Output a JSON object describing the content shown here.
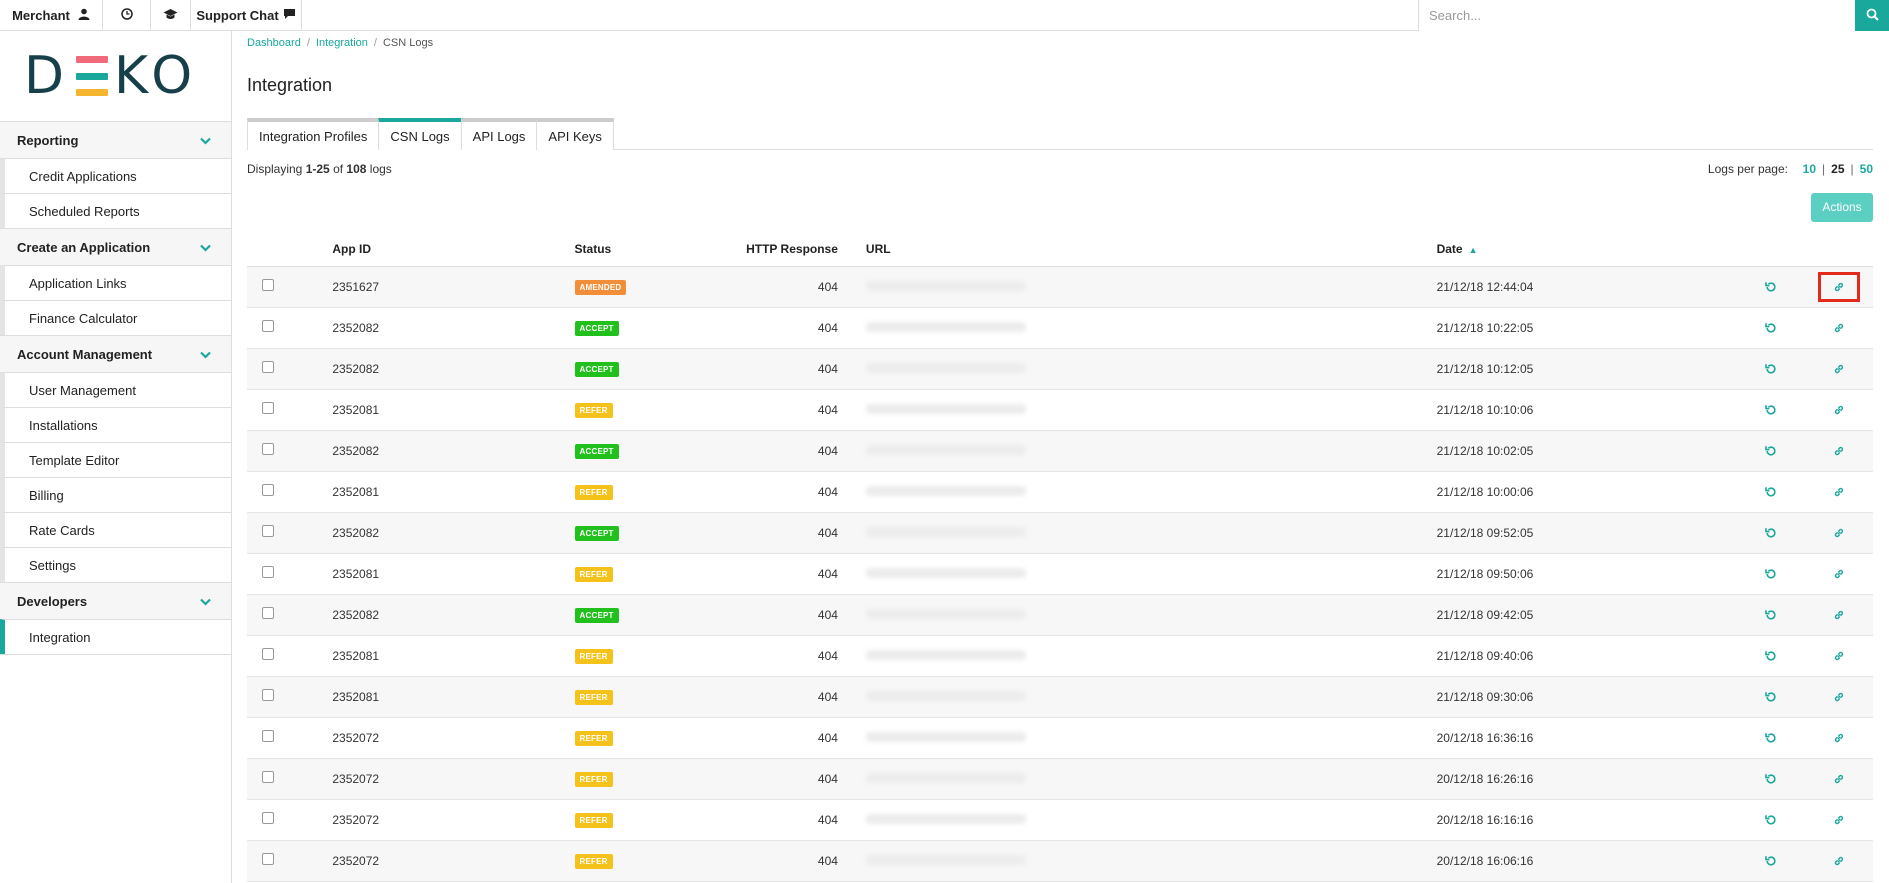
{
  "topbar": {
    "merchant_label": "Merchant",
    "support_label": "Support Chat",
    "search_placeholder": "Search..."
  },
  "logo": {
    "text_left": "D",
    "text_right": "KO",
    "bar_colors": [
      "#f06a7a",
      "#1aa89c",
      "#f5b52e"
    ]
  },
  "sidebar": {
    "groups": [
      {
        "title": "Reporting",
        "items": [
          "Credit Applications",
          "Scheduled Reports"
        ]
      },
      {
        "title": "Create an Application",
        "items": [
          "Application Links",
          "Finance Calculator"
        ]
      },
      {
        "title": "Account Management",
        "items": [
          "User Management",
          "Installations",
          "Template Editor",
          "Billing",
          "Rate Cards",
          "Settings"
        ]
      },
      {
        "title": "Developers",
        "items": [
          "Integration"
        ]
      }
    ]
  },
  "breadcrumb": {
    "items": [
      "Dashboard",
      "Integration",
      "CSN Logs"
    ]
  },
  "page_title": "Integration",
  "tabs": [
    "Integration Profiles",
    "CSN Logs",
    "API Logs",
    "API Keys"
  ],
  "display": {
    "prefix": "Displaying ",
    "range": "1-25",
    "of": " of ",
    "total": "108",
    "suffix": " logs"
  },
  "per_page": {
    "label": "Logs per page:",
    "options": [
      "10",
      "25",
      "50"
    ]
  },
  "actions_label": "Actions",
  "table": {
    "headers": {
      "app_id": "App ID",
      "status": "Status",
      "http": "HTTP Response",
      "url": "URL",
      "date": "Date"
    },
    "rows": [
      {
        "app_id": "2351627",
        "status": "AMENDED",
        "http": "404",
        "date": "21/12/18 12:44:04"
      },
      {
        "app_id": "2352082",
        "status": "ACCEPT",
        "http": "404",
        "date": "21/12/18 10:22:05"
      },
      {
        "app_id": "2352082",
        "status": "ACCEPT",
        "http": "404",
        "date": "21/12/18 10:12:05"
      },
      {
        "app_id": "2352081",
        "status": "REFER",
        "http": "404",
        "date": "21/12/18 10:10:06"
      },
      {
        "app_id": "2352082",
        "status": "ACCEPT",
        "http": "404",
        "date": "21/12/18 10:02:05"
      },
      {
        "app_id": "2352081",
        "status": "REFER",
        "http": "404",
        "date": "21/12/18 10:00:06"
      },
      {
        "app_id": "2352082",
        "status": "ACCEPT",
        "http": "404",
        "date": "21/12/18 09:52:05"
      },
      {
        "app_id": "2352081",
        "status": "REFER",
        "http": "404",
        "date": "21/12/18 09:50:06"
      },
      {
        "app_id": "2352082",
        "status": "ACCEPT",
        "http": "404",
        "date": "21/12/18 09:42:05"
      },
      {
        "app_id": "2352081",
        "status": "REFER",
        "http": "404",
        "date": "21/12/18 09:40:06"
      },
      {
        "app_id": "2352081",
        "status": "REFER",
        "http": "404",
        "date": "21/12/18 09:30:06"
      },
      {
        "app_id": "2352072",
        "status": "REFER",
        "http": "404",
        "date": "20/12/18 16:36:16"
      },
      {
        "app_id": "2352072",
        "status": "REFER",
        "http": "404",
        "date": "20/12/18 16:26:16"
      },
      {
        "app_id": "2352072",
        "status": "REFER",
        "http": "404",
        "date": "20/12/18 16:16:16"
      },
      {
        "app_id": "2352072",
        "status": "REFER",
        "http": "404",
        "date": "20/12/18 16:06:16"
      }
    ]
  },
  "colors": {
    "accent": "#1aa89c",
    "amended": "#f28e3a",
    "accept": "#22c01c",
    "refer": "#f5c21b",
    "highlight": "#e32a1b"
  },
  "icons": {
    "retry": "refresh-icon",
    "link": "link-icon"
  }
}
